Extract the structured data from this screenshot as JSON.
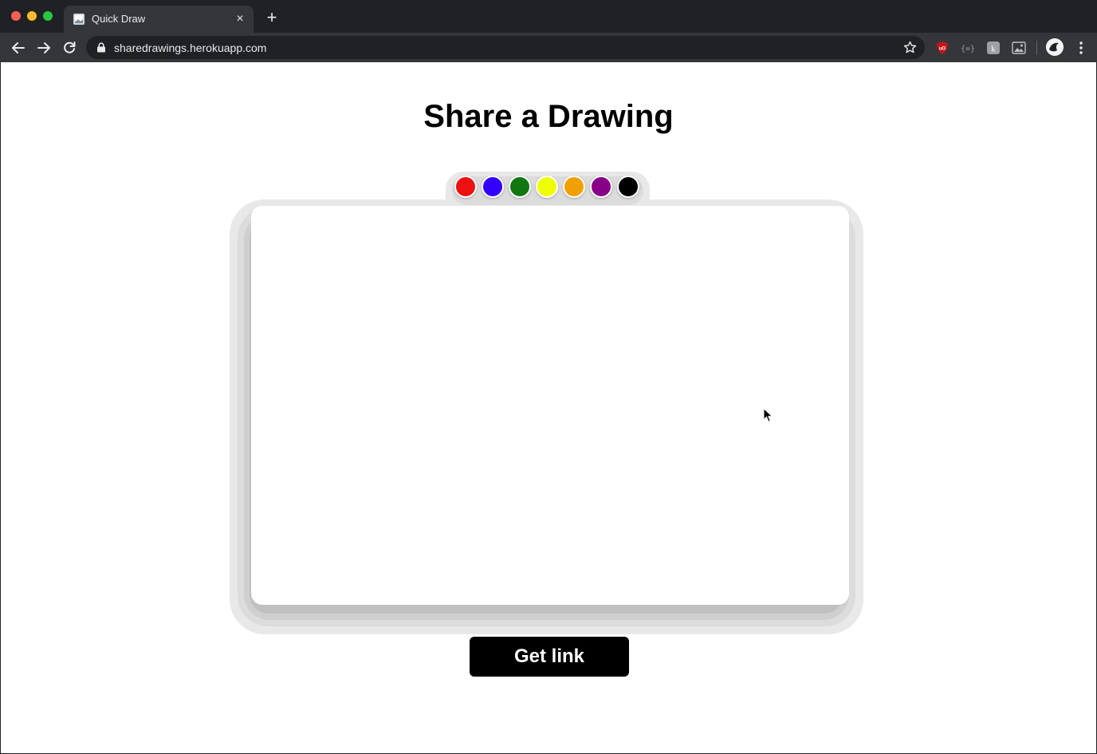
{
  "browser": {
    "tab": {
      "title": "Quick Draw",
      "close_glyph": "×"
    },
    "new_tab_glyph": "+",
    "url": "sharedrawings.herokuapp.com",
    "icons": [
      "back-icon",
      "forward-icon",
      "reload-icon",
      "lock-icon",
      "star-icon",
      "ublock-icon",
      "json-viewer-icon",
      "extension-k-icon",
      "image-extension-icon",
      "profile-avatar",
      "menu-icon"
    ]
  },
  "page": {
    "title": "Share a Drawing",
    "palette": {
      "colors": [
        "#ee1111",
        "#3300ff",
        "#117711",
        "#eeff00",
        "#f0a000",
        "#880088",
        "#000000"
      ],
      "color_names": [
        "red",
        "blue",
        "green",
        "yellow",
        "orange",
        "purple",
        "black"
      ]
    },
    "get_link_label": "Get link"
  }
}
